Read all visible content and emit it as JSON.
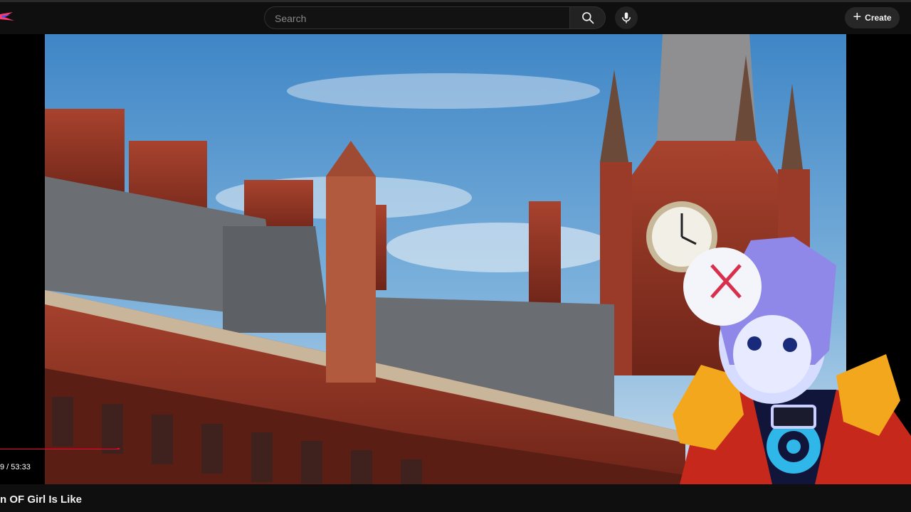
{
  "header": {
    "search": {
      "placeholder": "Search",
      "value": ""
    },
    "create_label": "Create",
    "icons": [
      "logo-icon",
      "search-icon",
      "microphone-icon",
      "plus-icon"
    ]
  },
  "player": {
    "time_display": "9 / 53:33",
    "progress_fraction": 0.13,
    "accent_color": "#ff0033"
  },
  "video": {
    "title": "n OF Girl Is Like"
  }
}
